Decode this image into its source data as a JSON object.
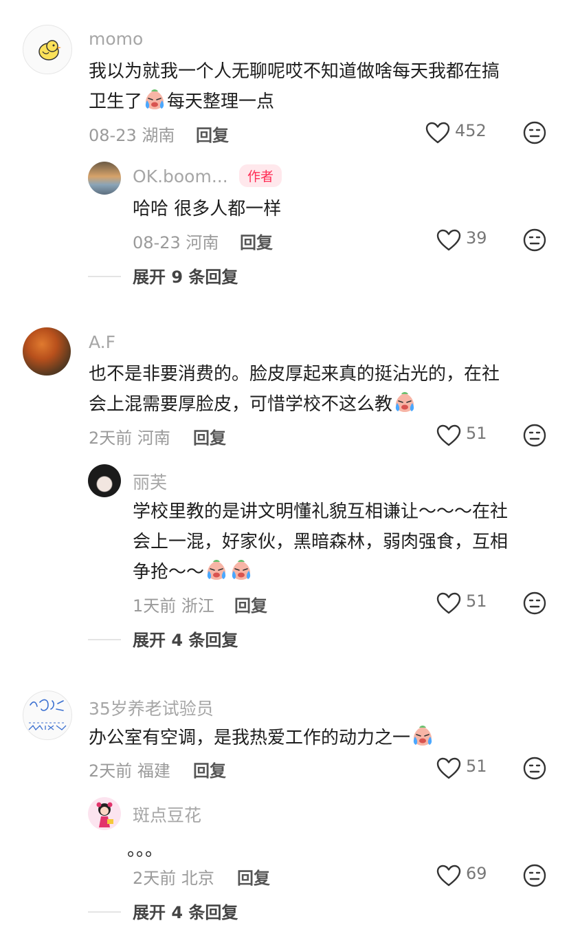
{
  "comments": [
    {
      "user": "momo",
      "text_line1": "我以为就我一个人无聊呢哎不知道做啥每天我都在搞",
      "text_line2a": "卫生了",
      "text_line2b": "每天整理一点",
      "date": "08-23",
      "location": "湖南",
      "reply_label": "回复",
      "likes": "452",
      "reply": {
        "user": "OK.boom...",
        "badge": "作者",
        "text": "哈哈 很多人都一样",
        "date": "08-23",
        "location": "河南",
        "reply_label": "回复",
        "likes": "39"
      },
      "expand": "展开 9 条回复"
    },
    {
      "user": "A.F",
      "text_line1": "也不是非要消费的。脸皮厚起来真的挺沾光的，在社",
      "text_line2": "会上混需要厚脸皮，可惜学校不这么教",
      "date": "2天前",
      "location": "河南",
      "reply_label": "回复",
      "likes": "51",
      "reply": {
        "user": "丽芙",
        "text_line1": "学校里教的是讲文明懂礼貌互相谦让～～～在社",
        "text_line2": "会上一混，好家伙，黑暗森林，弱肉强食，互相",
        "text_line3": "争抢～～",
        "date": "1天前",
        "location": "浙江",
        "reply_label": "回复",
        "likes": "51"
      },
      "expand": "展开 4 条回复"
    },
    {
      "user": "35岁养老试验员",
      "text": "办公室有空调，是我热爱工作的动力之一",
      "date": "2天前",
      "location": "福建",
      "reply_label": "回复",
      "likes": "51",
      "reply": {
        "user": "斑点豆花",
        "text": "。。。",
        "date": "2天前",
        "location": "北京",
        "reply_label": "回复",
        "likes": "69"
      },
      "expand": "展开 4 条回复"
    }
  ],
  "colors": {
    "author_badge_text": "#ff2d55",
    "author_badge_bg": "#ffe8ec",
    "username": "#a6a6a6"
  },
  "icons": [
    "heart-icon",
    "dislike-face-icon",
    "crying-emoji"
  ]
}
